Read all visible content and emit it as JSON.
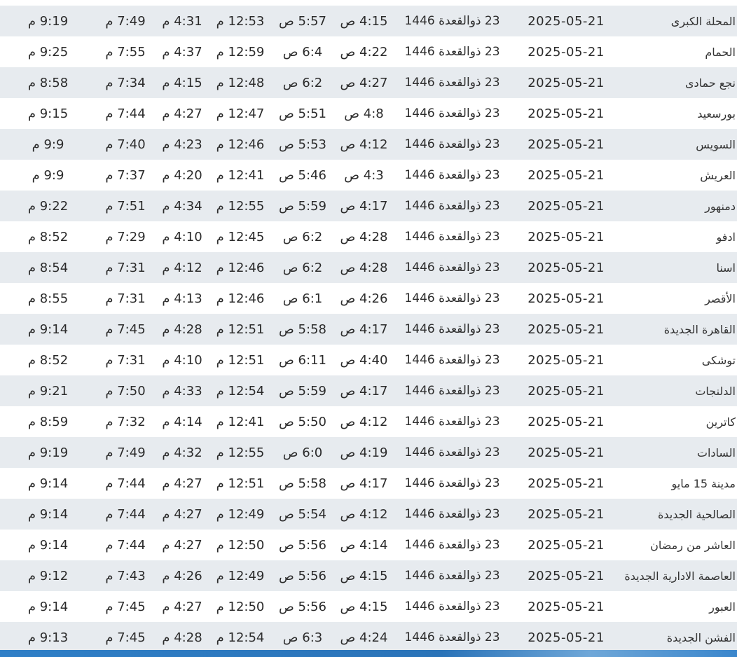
{
  "table": {
    "rows": [
      {
        "city": "المحلة الكبرى",
        "date": "2025-05-21",
        "hijri": "23 ذوالقعدة 1446",
        "fajr": "4:15 ص",
        "sunrise": "5:57 ص",
        "dhuhr": "12:53 م",
        "asr": "4:31 م",
        "maghrib": "7:49 م",
        "isha": "9:19 م"
      },
      {
        "city": "الحمام",
        "date": "2025-05-21",
        "hijri": "23 ذوالقعدة 1446",
        "fajr": "4:22 ص",
        "sunrise": "6:4 ص",
        "dhuhr": "12:59 م",
        "asr": "4:37 م",
        "maghrib": "7:55 م",
        "isha": "9:25 م"
      },
      {
        "city": "نجع حمادى",
        "date": "2025-05-21",
        "hijri": "23 ذوالقعدة 1446",
        "fajr": "4:27 ص",
        "sunrise": "6:2 ص",
        "dhuhr": "12:48 م",
        "asr": "4:15 م",
        "maghrib": "7:34 م",
        "isha": "8:58 م"
      },
      {
        "city": "بورسعيد",
        "date": "2025-05-21",
        "hijri": "23 ذوالقعدة 1446",
        "fajr": "4:8 ص",
        "sunrise": "5:51 ص",
        "dhuhr": "12:47 م",
        "asr": "4:27 م",
        "maghrib": "7:44 م",
        "isha": "9:15 م"
      },
      {
        "city": "السويس",
        "date": "2025-05-21",
        "hijri": "23 ذوالقعدة 1446",
        "fajr": "4:12 ص",
        "sunrise": "5:53 ص",
        "dhuhr": "12:46 م",
        "asr": "4:23 م",
        "maghrib": "7:40 م",
        "isha": "9:9 م"
      },
      {
        "city": "العريش",
        "date": "2025-05-21",
        "hijri": "23 ذوالقعدة 1446",
        "fajr": "4:3 ص",
        "sunrise": "5:46 ص",
        "dhuhr": "12:41 م",
        "asr": "4:20 م",
        "maghrib": "7:37 م",
        "isha": "9:9 م"
      },
      {
        "city": "دمنهور",
        "date": "2025-05-21",
        "hijri": "23 ذوالقعدة 1446",
        "fajr": "4:17 ص",
        "sunrise": "5:59 ص",
        "dhuhr": "12:55 م",
        "asr": "4:34 م",
        "maghrib": "7:51 م",
        "isha": "9:22 م"
      },
      {
        "city": "ادفو",
        "date": "2025-05-21",
        "hijri": "23 ذوالقعدة 1446",
        "fajr": "4:28 ص",
        "sunrise": "6:2 ص",
        "dhuhr": "12:45 م",
        "asr": "4:10 م",
        "maghrib": "7:29 م",
        "isha": "8:52 م"
      },
      {
        "city": "اسنا",
        "date": "2025-05-21",
        "hijri": "23 ذوالقعدة 1446",
        "fajr": "4:28 ص",
        "sunrise": "6:2 ص",
        "dhuhr": "12:46 م",
        "asr": "4:12 م",
        "maghrib": "7:31 م",
        "isha": "8:54 م"
      },
      {
        "city": "الأقصر",
        "date": "2025-05-21",
        "hijri": "23 ذوالقعدة 1446",
        "fajr": "4:26 ص",
        "sunrise": "6:1 ص",
        "dhuhr": "12:46 م",
        "asr": "4:13 م",
        "maghrib": "7:31 م",
        "isha": "8:55 م"
      },
      {
        "city": "القاهرة الجديدة",
        "date": "2025-05-21",
        "hijri": "23 ذوالقعدة 1446",
        "fajr": "4:17 ص",
        "sunrise": "5:58 ص",
        "dhuhr": "12:51 م",
        "asr": "4:28 م",
        "maghrib": "7:45 م",
        "isha": "9:14 م"
      },
      {
        "city": "توشكى",
        "date": "2025-05-21",
        "hijri": "23 ذوالقعدة 1446",
        "fajr": "4:40 ص",
        "sunrise": "6:11 ص",
        "dhuhr": "12:51 م",
        "asr": "4:10 م",
        "maghrib": "7:31 م",
        "isha": "8:52 م"
      },
      {
        "city": "الدلنجات",
        "date": "2025-05-21",
        "hijri": "23 ذوالقعدة 1446",
        "fajr": "4:17 ص",
        "sunrise": "5:59 ص",
        "dhuhr": "12:54 م",
        "asr": "4:33 م",
        "maghrib": "7:50 م",
        "isha": "9:21 م"
      },
      {
        "city": "كاترين",
        "date": "2025-05-21",
        "hijri": "23 ذوالقعدة 1446",
        "fajr": "4:12 ص",
        "sunrise": "5:50 ص",
        "dhuhr": "12:41 م",
        "asr": "4:14 م",
        "maghrib": "7:32 م",
        "isha": "8:59 م"
      },
      {
        "city": "السادات",
        "date": "2025-05-21",
        "hijri": "23 ذوالقعدة 1446",
        "fajr": "4:19 ص",
        "sunrise": "6:0 ص",
        "dhuhr": "12:55 م",
        "asr": "4:32 م",
        "maghrib": "7:49 م",
        "isha": "9:19 م"
      },
      {
        "city": "مدينة 15 مايو",
        "date": "2025-05-21",
        "hijri": "23 ذوالقعدة 1446",
        "fajr": "4:17 ص",
        "sunrise": "5:58 ص",
        "dhuhr": "12:51 م",
        "asr": "4:27 م",
        "maghrib": "7:44 م",
        "isha": "9:14 م"
      },
      {
        "city": "الصالحية الجديدة",
        "date": "2025-05-21",
        "hijri": "23 ذوالقعدة 1446",
        "fajr": "4:12 ص",
        "sunrise": "5:54 ص",
        "dhuhr": "12:49 م",
        "asr": "4:27 م",
        "maghrib": "7:44 م",
        "isha": "9:14 م"
      },
      {
        "city": "العاشر من رمضان",
        "date": "2025-05-21",
        "hijri": "23 ذوالقعدة 1446",
        "fajr": "4:14 ص",
        "sunrise": "5:56 ص",
        "dhuhr": "12:50 م",
        "asr": "4:27 م",
        "maghrib": "7:44 م",
        "isha": "9:14 م"
      },
      {
        "city": "العاصمة الادارية الجديدة",
        "date": "2025-05-21",
        "hijri": "23 ذوالقعدة 1446",
        "fajr": "4:15 ص",
        "sunrise": "5:56 ص",
        "dhuhr": "12:49 م",
        "asr": "4:26 م",
        "maghrib": "7:43 م",
        "isha": "9:12 م"
      },
      {
        "city": "العبور",
        "date": "2025-05-21",
        "hijri": "23 ذوالقعدة 1446",
        "fajr": "4:15 ص",
        "sunrise": "5:56 ص",
        "dhuhr": "12:50 م",
        "asr": "4:27 م",
        "maghrib": "7:45 م",
        "isha": "9:14 م"
      },
      {
        "city": "الفشن الجديدة",
        "date": "2025-05-21",
        "hijri": "23 ذوالقعدة 1446",
        "fajr": "4:24 ص",
        "sunrise": "6:3 ص",
        "dhuhr": "12:54 م",
        "asr": "4:28 م",
        "maghrib": "7:45 م",
        "isha": "9:13 م"
      }
    ]
  },
  "colors": {
    "row_alt": "#e7ebef",
    "row_plain": "#ffffff",
    "text": "#2b2b2b",
    "bottom_bar": "#2f7fc7"
  }
}
